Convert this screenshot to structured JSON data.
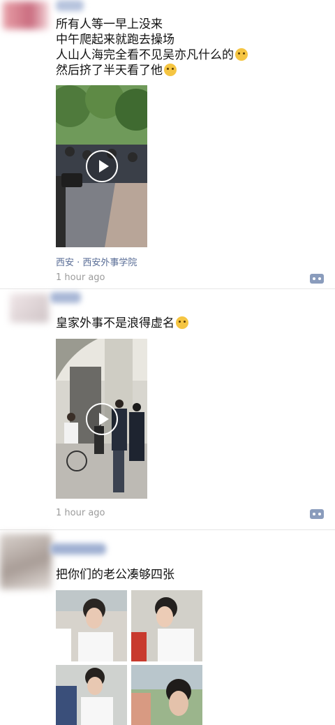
{
  "posts": [
    {
      "lines": [
        "所有人等一早上没来",
        "中午爬起来就跑去操场",
        "人山人海完全看不见吴亦凡什么的",
        "然后挤了半天看了他"
      ],
      "location": "西安 · 西安外事学院",
      "time": "1 hour ago",
      "emojis": [
        "sweat-laugh-emoji",
        "tears-of-joy-emoji"
      ]
    },
    {
      "lines": [
        "皇家外事不是浪得虚名"
      ],
      "time": "1 hour ago",
      "emojis": [
        "flushed-emoji"
      ]
    },
    {
      "lines": [
        "把你们的老公凑够四张"
      ]
    }
  ]
}
